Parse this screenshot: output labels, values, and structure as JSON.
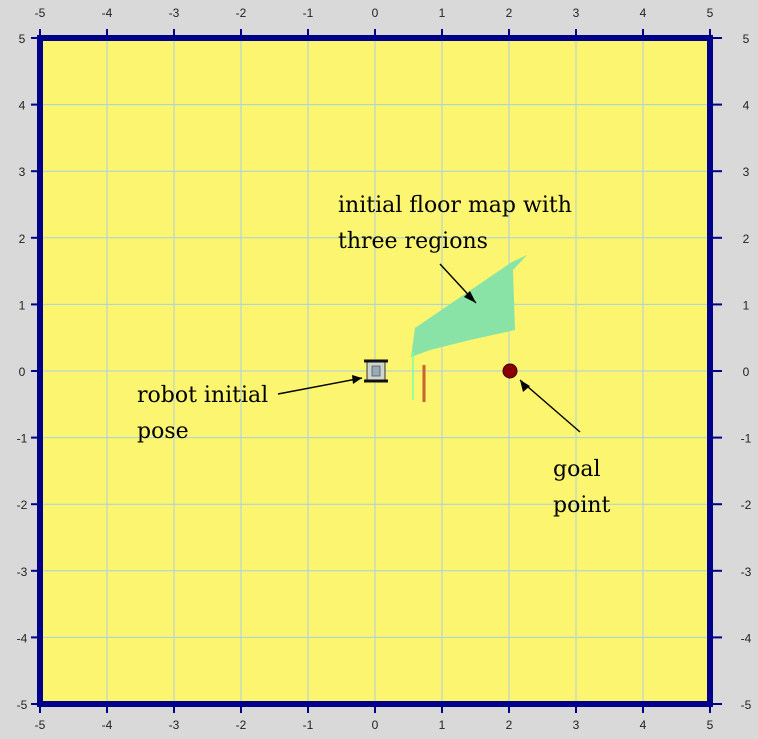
{
  "window": {
    "background": "#d9d9d9"
  },
  "plot": {
    "xlim": [
      -5,
      5
    ],
    "ylim": [
      -5,
      5
    ],
    "grid": true,
    "top_ticks": [
      "-5",
      "-4",
      "-3",
      "-2",
      "-1",
      "0",
      "1",
      "2",
      "3",
      "4",
      "5"
    ],
    "bottom_ticks": [
      "-5",
      "-4",
      "-3",
      "-2",
      "-1",
      "0",
      "1",
      "2",
      "3",
      "4",
      "5"
    ],
    "left_ticks": [
      "5",
      "4",
      "3",
      "2",
      "1",
      "0",
      "-1",
      "-2",
      "-3",
      "-4",
      "-5"
    ],
    "right_ticks": [
      "5",
      "4",
      "3",
      "2",
      "1",
      "0",
      "-1",
      "-2",
      "-3",
      "-4",
      "-5"
    ],
    "colors": {
      "plot_background": "#fbf56f",
      "grid": "#a8cfe3",
      "frame": "#00008b",
      "floor_map_region": "#8ae3a6",
      "goal_point": "#8b0000",
      "robot": "#1a1a1a",
      "wall_segment": "#c8642a"
    }
  },
  "annotations": {
    "floor_map": "initial floor map with\nthree regions",
    "robot_pose": "robot initial\npose",
    "goal": "goal\npoint"
  },
  "markers": {
    "robot": {
      "x": 0.0,
      "y": 0.0
    },
    "goal": {
      "x": 2.0,
      "y": 0.0
    }
  }
}
